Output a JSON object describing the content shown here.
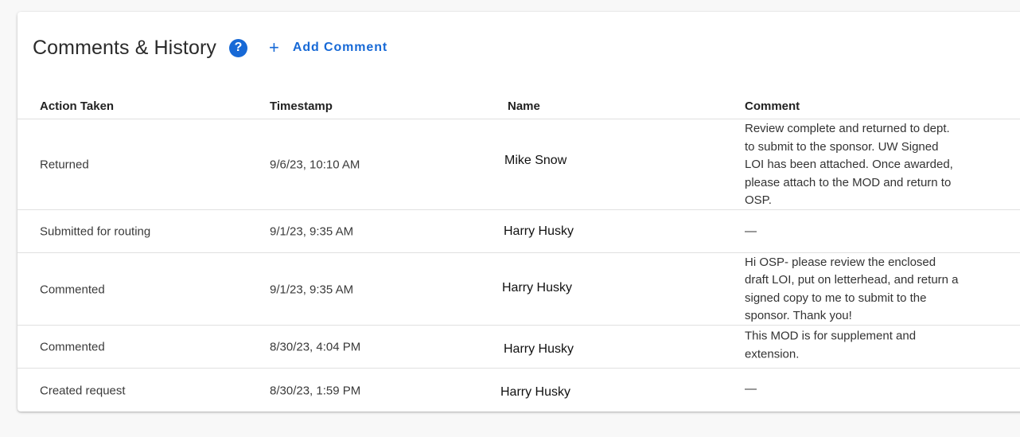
{
  "section": {
    "title": "Comments & History",
    "help_icon": "?",
    "add_icon": "+",
    "add_comment_label": "Add Comment"
  },
  "colors": {
    "accent": "#1769d6"
  },
  "table": {
    "headers": [
      "Action Taken",
      "Timestamp",
      "Name",
      "Comment"
    ],
    "rows": [
      {
        "action": "Returned",
        "timestamp": "9/6/23, 10:10 AM",
        "name": "Mike Snow",
        "comment": "Review complete and returned to dept. to submit to the sponsor. UW Signed LOI has been attached. Once awarded, please attach to the MOD and return to OSP."
      },
      {
        "action": "Submitted for routing",
        "timestamp": "9/1/23, 9:35 AM",
        "name": "Harry Husky",
        "comment": "—"
      },
      {
        "action": "Commented",
        "timestamp": "9/1/23, 9:35 AM",
        "name": "Harry Husky",
        "comment": "Hi OSP- please review the enclosed draft LOI, put on letterhead, and return a signed copy to me to submit to the sponsor.  Thank you!"
      },
      {
        "action": "Commented",
        "timestamp": "8/30/23, 4:04 PM",
        "name": "Harry Husky",
        "comment": "This MOD is for supplement and extension."
      },
      {
        "action": "Created request",
        "timestamp": "8/30/23, 1:59 PM",
        "name": "Harry Husky",
        "comment": "—"
      }
    ]
  }
}
